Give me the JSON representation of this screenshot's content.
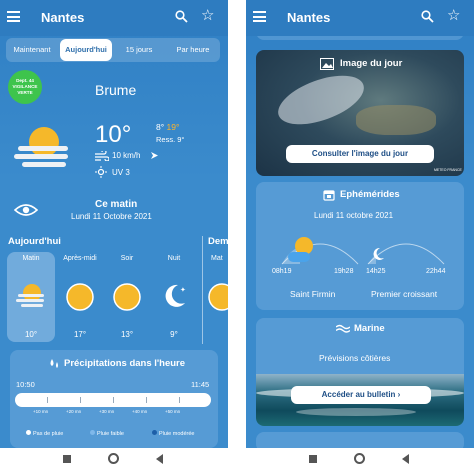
{
  "left": {
    "city": "Nantes",
    "tabs": [
      "Maintenant",
      "Aujourd'hui",
      "15 jours",
      "Par heure"
    ],
    "vigilance": {
      "dept": "Dept. 44",
      "label": "VIGILANCE",
      "level": "VERTE"
    },
    "condition": "Brume",
    "temperature": "10°",
    "min": "8°",
    "max": "19°",
    "feels": "Ress. 9°",
    "wind": "10 km/h",
    "uv": "UV 3",
    "period_title": "Ce matin",
    "period_date": "Lundi 11 Octobre 2021",
    "section_today": "Aujourd'hui",
    "section_next": "Dem",
    "hourly": [
      {
        "label": "Matin",
        "temp": "10°",
        "icon": "fog-sun-icon"
      },
      {
        "label": "Après-midi",
        "temp": "17°",
        "icon": "sun-icon"
      },
      {
        "label": "Soir",
        "temp": "13°",
        "icon": "sun-icon"
      },
      {
        "label": "Nuit",
        "temp": "9°",
        "icon": "moon-stars-icon"
      },
      {
        "label": "Mat",
        "temp": "",
        "icon": "sun-icon"
      }
    ],
    "precip": {
      "title": "Précipitations dans l'heure",
      "start": "10:50",
      "end": "11:45",
      "ticks": [
        "+10 mn",
        "+20 mn",
        "+30 mn",
        "+40 mn",
        "+50 mn"
      ],
      "legend": [
        "Pas de pluie",
        "Pluie faible",
        "Pluie modérée"
      ],
      "legend_colors": [
        "#ffffff",
        "#7fb8ea",
        "#1d5fa8"
      ]
    }
  },
  "right": {
    "city": "Nantes",
    "image_title": "Image du jour",
    "image_button": "Consulter l'image du jour",
    "image_credit": "METEO FRANCE",
    "ephem_title": "Ephémérides",
    "ephem_date": "Lundi 11 octobre 2021",
    "sunrise": "08h19",
    "sunset": "19h28",
    "moonrise": "14h25",
    "moonset": "22h44",
    "saint": "Saint Firmin",
    "moon_phase": "Premier croissant",
    "marine_title": "Marine",
    "marine_sub": "Prévisions côtières",
    "marine_button": "Accéder au bulletin"
  }
}
